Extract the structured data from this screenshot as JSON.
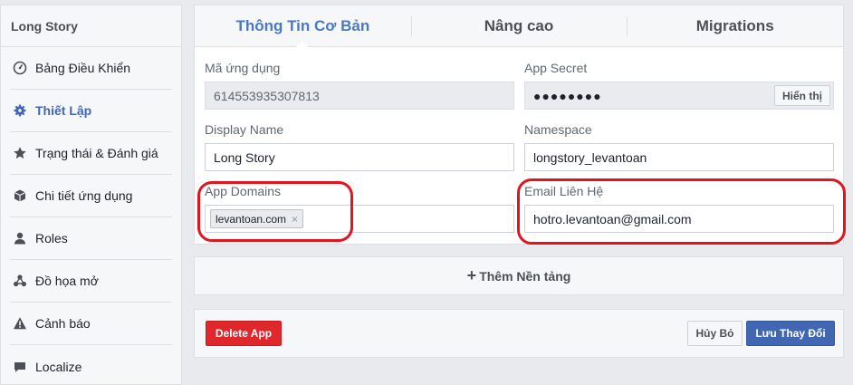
{
  "sidebar": {
    "title": "Long Story",
    "items": [
      {
        "label": "Bảng Điều Khiển",
        "icon": "dashboard-icon"
      },
      {
        "label": "Thiết Lập",
        "icon": "gear-icon"
      },
      {
        "label": "Trạng thái & Đánh giá",
        "icon": "star-icon"
      },
      {
        "label": "Chi tiết ứng dụng",
        "icon": "box-icon"
      },
      {
        "label": "Roles",
        "icon": "user-icon"
      },
      {
        "label": "Đồ họa mở",
        "icon": "graph-icon"
      },
      {
        "label": "Cảnh báo",
        "icon": "warning-icon"
      },
      {
        "label": "Localize",
        "icon": "chat-icon"
      }
    ]
  },
  "tabs": [
    {
      "label": "Thông Tin Cơ Bản"
    },
    {
      "label": "Nâng cao"
    },
    {
      "label": "Migrations"
    }
  ],
  "form": {
    "app_id_label": "Mã ứng dụng",
    "app_id_value": "614553935307813",
    "secret_label": "App Secret",
    "secret_value": "●●●●●●●●",
    "show_label": "Hiển thị",
    "display_name_label": "Display Name",
    "display_name_value": "Long Story",
    "namespace_label": "Namespace",
    "namespace_value": "longstory_levantoan",
    "domains_label": "App Domains",
    "domain_token": "levantoan.com",
    "domain_token_remove": "×",
    "email_label": "Email Liên Hệ",
    "email_value": "hotro.levantoan@gmail.com"
  },
  "add_platform": {
    "plus": "+",
    "label": "Thêm Nền tảng"
  },
  "footer": {
    "delete_label": "Delete App",
    "cancel_label": "Hủy Bỏ",
    "save_label": "Lưu Thay Đổi"
  },
  "colors": {
    "accent": "#4267b2",
    "danger": "#e0272c",
    "annotation": "#e3141d"
  }
}
